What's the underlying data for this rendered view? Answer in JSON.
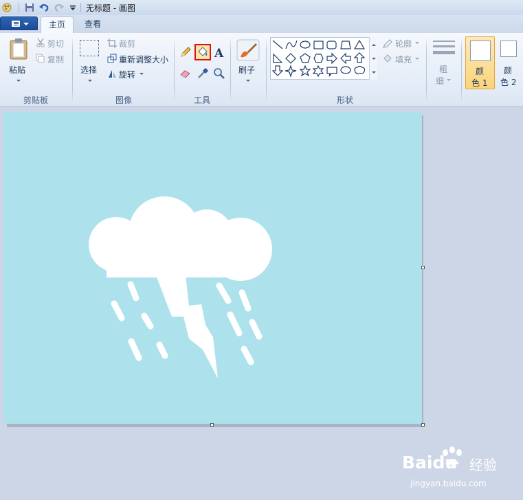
{
  "window": {
    "title": "无标题 - 画图"
  },
  "tabs": [
    {
      "label": "主页",
      "active": true
    },
    {
      "label": "查看",
      "active": false
    }
  ],
  "ribbon": {
    "clipboard": {
      "paste": "粘贴",
      "cut": "剪切",
      "copy": "复制",
      "group": "剪贴板"
    },
    "image": {
      "select": "选择",
      "crop": "裁剪",
      "resize": "重新调整大小",
      "rotate": "旋转",
      "group": "图像"
    },
    "tools": {
      "group": "工具",
      "highlighted_tool": "fill-with-color"
    },
    "brushes": {
      "label": "刷子"
    },
    "shapes": {
      "outline": "轮廓",
      "fill": "填充",
      "group": "形状"
    },
    "size": {
      "line1": "粗",
      "line2": "细"
    },
    "colors": {
      "color1_line1": "颜",
      "color1_line2": "色 1",
      "color2_line1": "颜",
      "color2_line2": "色 2",
      "color1_value": "#ffffff",
      "color2_value": "#ffffff"
    }
  },
  "canvas": {
    "background": "#ade2ec",
    "drawing": "white-thunderstorm-cloud"
  },
  "watermark": {
    "brand": "Baidu",
    "brand_cn": "经验",
    "url": "jingyan.baidu.com"
  },
  "colors": {
    "accent": "#2f66b6",
    "highlight_border": "#e01010",
    "active_tile": "#fbd47a"
  }
}
